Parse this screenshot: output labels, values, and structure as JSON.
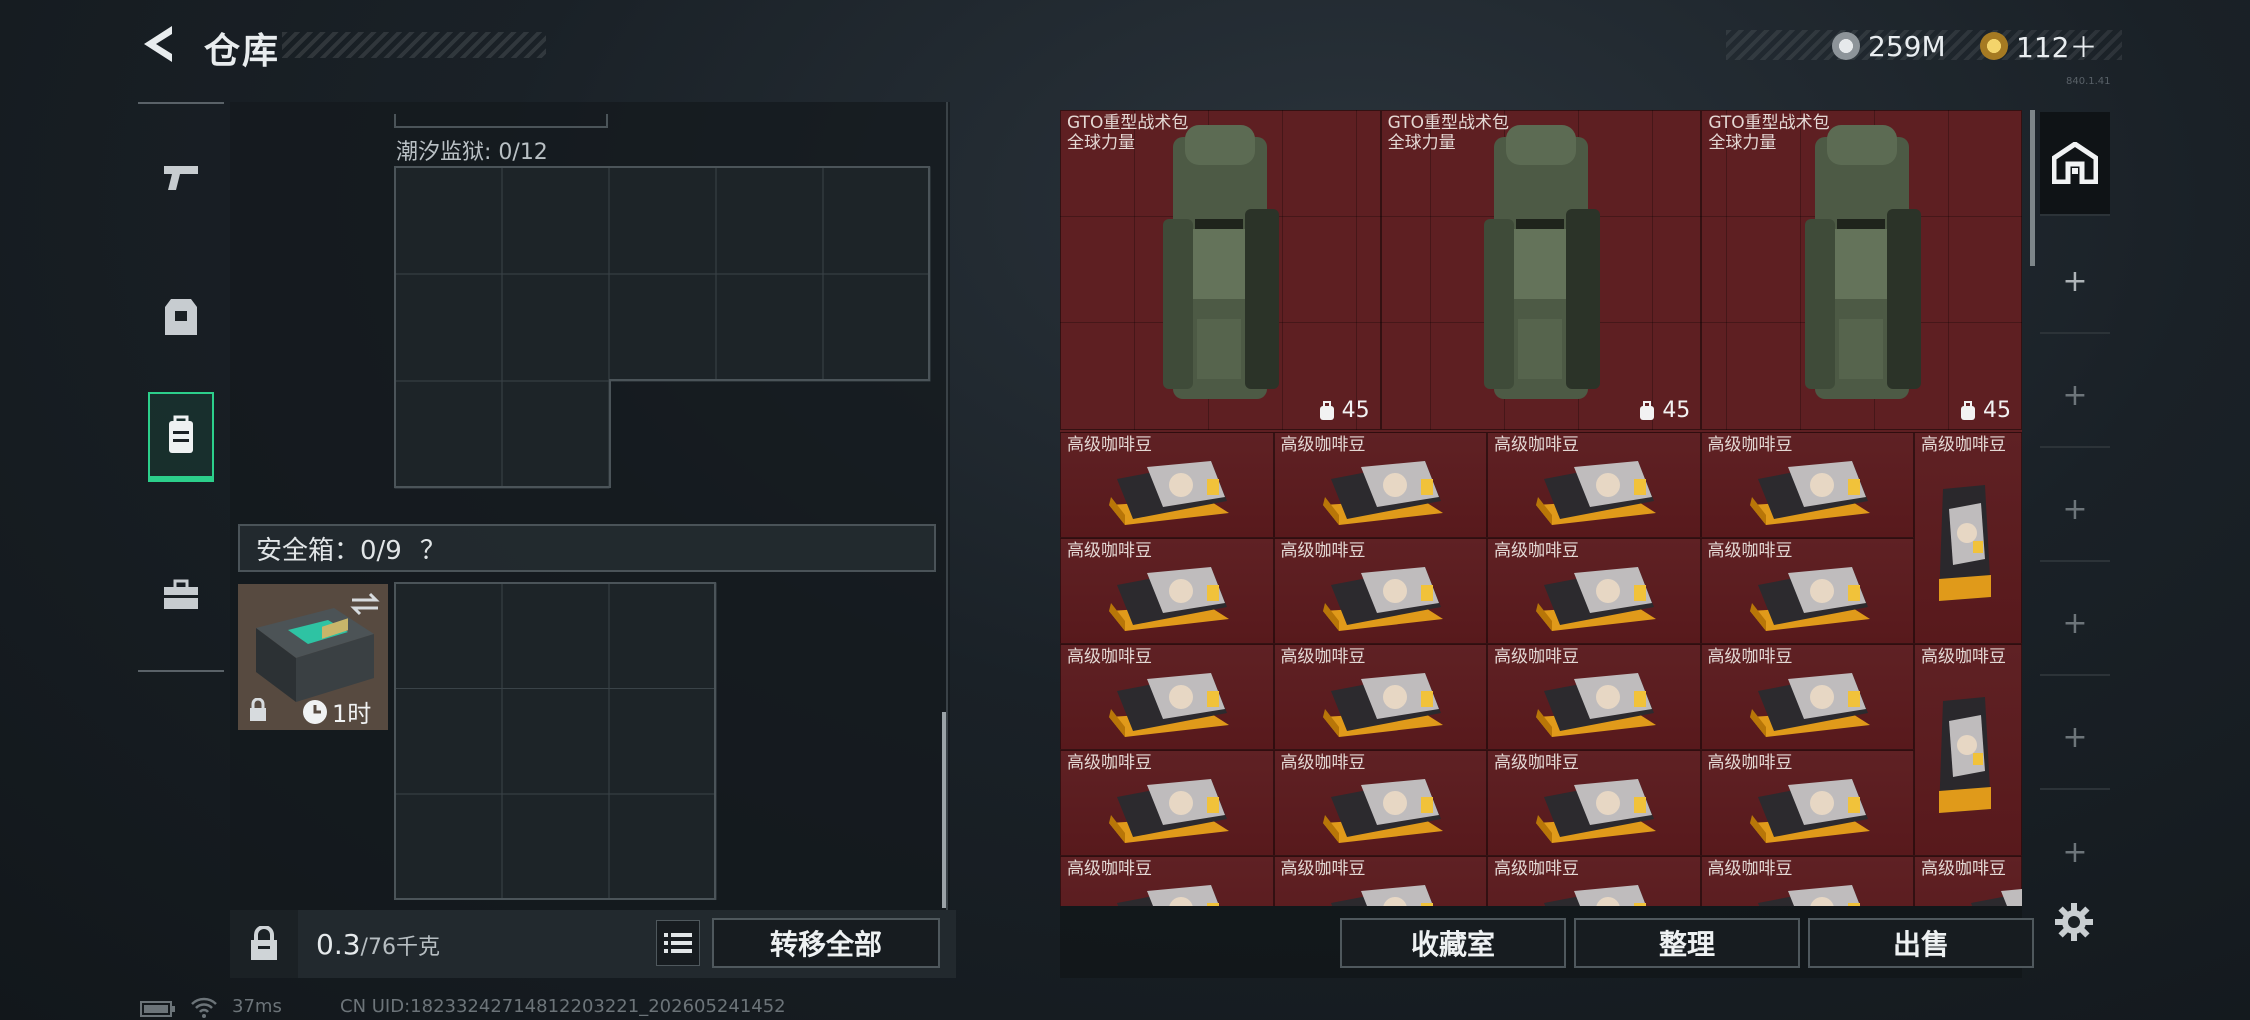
{
  "header": {
    "title": "仓库",
    "silver": "259M",
    "gold": "112＋",
    "version": "840.1.41"
  },
  "rail": {
    "items": [
      "pistol-icon",
      "armor-icon",
      "backpack-icon",
      "briefcase-icon"
    ],
    "selected": 2
  },
  "container": {
    "tide_label": "潮汐监狱: 0/12",
    "safe_label": "安全箱：0/9",
    "safe_help": "？",
    "safe_timer": "1时"
  },
  "footer_left": {
    "weight_value": "0.3",
    "weight_cap": "/76千克",
    "transfer_all": "转移全部"
  },
  "stash": {
    "backpacks": [
      {
        "name": "GTO重型战术包",
        "subtitle": "全球力量",
        "count": "45"
      },
      {
        "name": "GTO重型战术包",
        "subtitle": "全球力量",
        "count": "45"
      },
      {
        "name": "GTO重型战术包",
        "subtitle": "全球力量",
        "count": "45"
      }
    ],
    "coffee_name": "高级咖啡豆",
    "buttons": {
      "collection": "收藏室",
      "sort": "整理",
      "sell": "出售"
    }
  },
  "status_bar": {
    "ping": "37ms",
    "uid": "CN UID:1823324271481220322‌1_202605241452"
  },
  "colors": {
    "accent": "#2ccf8b",
    "stash_bg": "#5e1f22"
  }
}
